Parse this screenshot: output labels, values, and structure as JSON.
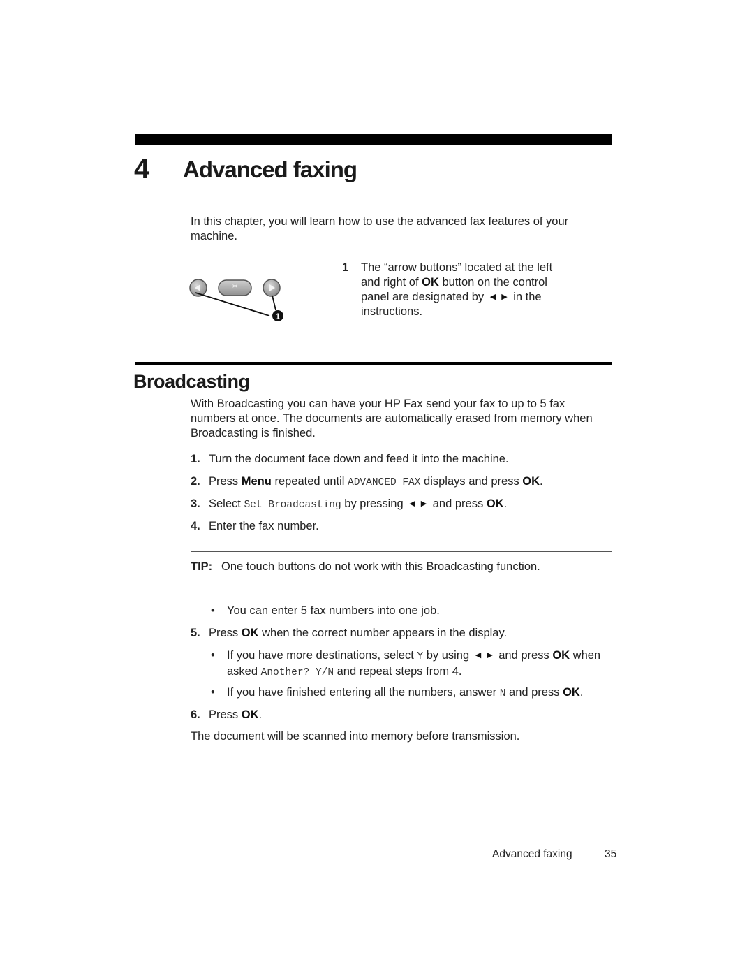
{
  "chapter": {
    "number": "4",
    "title": "Advanced faxing",
    "intro": "In this chapter, you will learn how to use the advanced fax features of your machine."
  },
  "figure": {
    "left_button_icon": "left-arrow-button",
    "center_button_icon": "star-button",
    "center_button_glyph": "*",
    "right_button_icon": "right-arrow-button",
    "callout_marker": "1"
  },
  "callout": {
    "number": "1",
    "text_before_ok": "The “arrow buttons” located at the left and right of ",
    "ok": "OK",
    "text_after_ok": " button on the control panel are designated by ",
    "left_arrow": "◀",
    "right_arrow": "▶",
    "text_end": " in the instructions."
  },
  "section": {
    "title": "Broadcasting",
    "intro": "With Broadcasting you can have your HP Fax send your fax to up to 5 fax numbers at once. The documents are automatically erased from memory when Broadcasting is finished."
  },
  "steps": {
    "s1": {
      "num": "1.",
      "text": "Turn the document face down and feed it into the machine."
    },
    "s2": {
      "num": "2.",
      "a": "Press ",
      "menu": "Menu",
      "b": " repeated until ",
      "code": "ADVANCED FAX",
      "c": " displays and press ",
      "ok": "OK",
      "d": "."
    },
    "s3": {
      "num": "3.",
      "a": "Select ",
      "code": "Set Broadcasting",
      "b": " by pressing ",
      "left_arrow": "◀",
      "right_arrow": "▶",
      "c": " and press ",
      "ok": "OK",
      "d": "."
    },
    "s4": {
      "num": "4.",
      "text": "Enter the fax number."
    },
    "s5": {
      "num": "5.",
      "a": "Press ",
      "ok": "OK",
      "b": " when the correct number appears in the display."
    },
    "s6": {
      "num": "6.",
      "a": "Press ",
      "ok": "OK",
      "b": "."
    }
  },
  "tip": {
    "label": "TIP:",
    "text": "One touch buttons do not work with this Broadcasting function."
  },
  "bullets": {
    "b1": {
      "dot": "•",
      "text": "You can enter 5 fax numbers into one job."
    },
    "b2": {
      "dot": "•",
      "a": "If you have more destinations, select ",
      "code1": "Y",
      "b": " by using ",
      "left_arrow": "◀",
      "right_arrow": "▶",
      "c": " and press ",
      "ok": "OK",
      "d": " when asked ",
      "code2": "Another? Y/N",
      "e": " and repeat steps from 4."
    },
    "b3": {
      "dot": "•",
      "a": "If you have finished entering all the numbers, answer ",
      "code": "N",
      "b": " and press ",
      "ok": "OK",
      "c": "."
    }
  },
  "closing": "The document will be scanned into memory before transmission.",
  "footer": {
    "title": "Advanced faxing",
    "page": "35"
  }
}
